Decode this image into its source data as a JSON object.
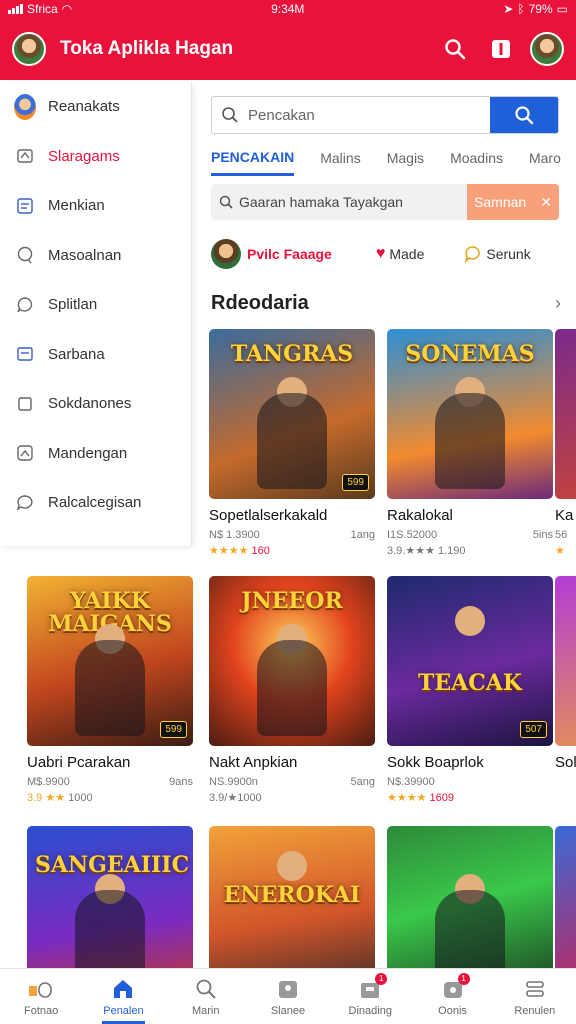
{
  "status_bar": {
    "carrier": "Sfrica",
    "time": "9:34M",
    "battery": "79%"
  },
  "app_bar": {
    "title": "Toka Aplikla Hagan",
    "icons": [
      "avatar",
      "search-icon",
      "info-icon",
      "avatar"
    ]
  },
  "sidebar": {
    "items": [
      {
        "label": "Reanakats",
        "icon": "avatar"
      },
      {
        "label": "Slaragams",
        "icon": "gamepad-icon",
        "active": true
      },
      {
        "label": "Menkian",
        "icon": "list-icon"
      },
      {
        "label": "Masoalnan",
        "icon": "chat-icon"
      },
      {
        "label": "Splitlan",
        "icon": "chat-bubble-icon"
      },
      {
        "label": "Sarbana",
        "icon": "document-icon"
      },
      {
        "label": "Sokdanones",
        "icon": "square-icon"
      },
      {
        "label": "Mandengan",
        "icon": "image-icon"
      },
      {
        "label": "Ralcalcegisan",
        "icon": "chat-icon"
      }
    ]
  },
  "search": {
    "placeholder": "Pencakan"
  },
  "tabs": [
    "PENCAKAIN",
    "Malins",
    "Magis",
    "Moadins",
    "Maro"
  ],
  "hint": {
    "text": "Gaaran hamaka Tayakgan",
    "action": "Samnan"
  },
  "filters": {
    "first": "Pvilc Faaage",
    "second": "Made",
    "third": "Serunk"
  },
  "section": {
    "title": "Rdeodaria"
  },
  "cards": [
    {
      "name": "Sopetlalserkakald",
      "logo": "TANGRAS",
      "meta_left": "N$ 1.3900",
      "meta_right": "1ang",
      "rating_text": "160",
      "stars": "★★★★"
    },
    {
      "name": "Rakalokal",
      "logo": "SONEMAS",
      "meta_left": "I1S.52000",
      "meta_right": "5ins",
      "rating_text": "3.9.★★★ 1.190",
      "stars": ""
    },
    {
      "name": "Ka",
      "logo": "",
      "meta_left": "56",
      "meta_right": "",
      "rating_text": "",
      "stars": "★"
    },
    {
      "name": "Uabri Pcarakan",
      "logo": "YAIKK MAIGANS",
      "meta_left": "M$.9900",
      "meta_right": "9ans",
      "rating_text": "1000",
      "stars": "3.9 ★★"
    },
    {
      "name": "Nakt Anpkian",
      "logo": "JNEEOR",
      "meta_left": "NS.9900n",
      "meta_right": "5ang",
      "rating_text": "3.9/★1000",
      "stars": ""
    },
    {
      "name": "Sokk Boaprlok",
      "logo": "TEACAK",
      "meta_left": "N$.39900",
      "meta_right": "",
      "rating_text": "1609",
      "stars": "★★★★"
    },
    {
      "name": "Sol",
      "logo": "",
      "meta_left": "",
      "meta_right": "",
      "rating_text": "",
      "stars": ""
    },
    {
      "name": "",
      "logo": "SANGEAIIIC",
      "meta_left": "",
      "meta_right": "",
      "rating_text": "",
      "stars": ""
    },
    {
      "name": "",
      "logo": "ENEROKAI",
      "meta_left": "",
      "meta_right": "",
      "rating_text": "",
      "stars": ""
    },
    {
      "name": "",
      "logo": "",
      "meta_left": "",
      "meta_right": "",
      "rating_text": "",
      "stars": ""
    }
  ],
  "bottom_nav": [
    {
      "label": "Fotnao",
      "icon": "home-toggle-icon"
    },
    {
      "label": "Penalen",
      "icon": "home-icon",
      "active": true
    },
    {
      "label": "Marin",
      "icon": "search-icon"
    },
    {
      "label": "Slanee",
      "icon": "gift-icon"
    },
    {
      "label": "Dinading",
      "icon": "briefcase-icon",
      "badge": "1"
    },
    {
      "label": "Oonis",
      "icon": "bell-icon",
      "badge": "1"
    },
    {
      "label": "Renulen",
      "icon": "menu-icon"
    }
  ],
  "colors": {
    "primary": "#e8123b",
    "accent": "#1f5fd8",
    "hint_action": "#f8a07a"
  }
}
